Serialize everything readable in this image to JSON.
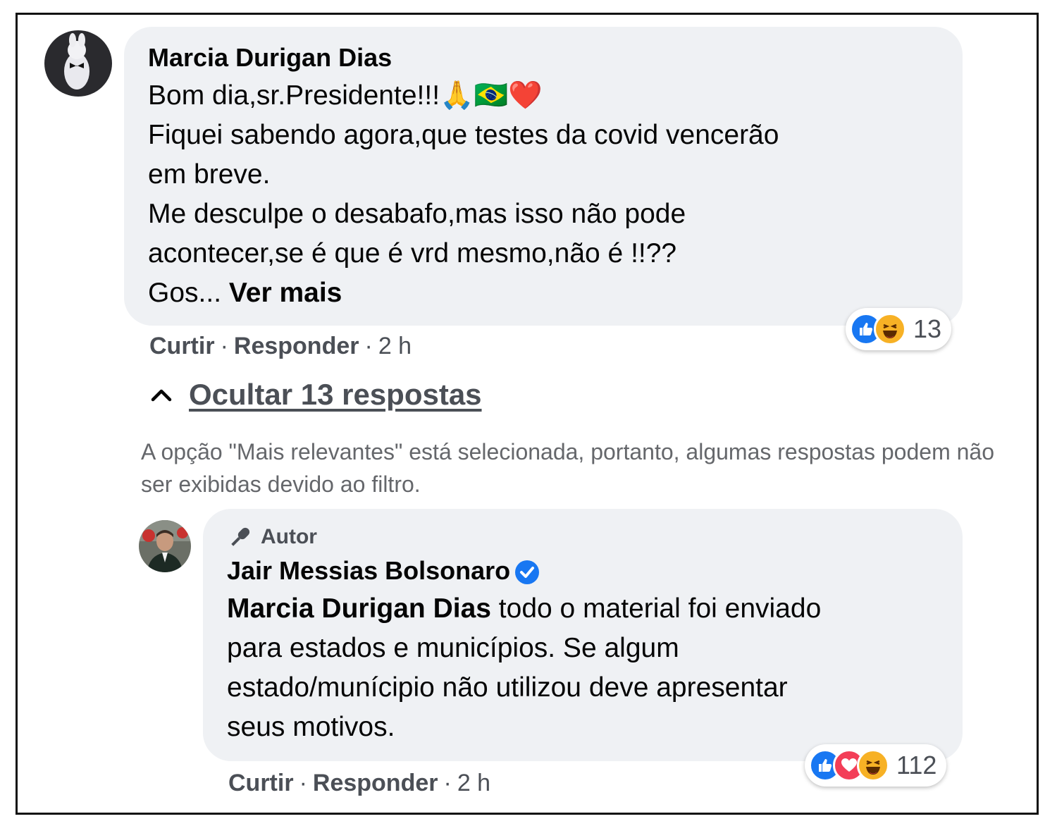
{
  "comment": {
    "author": "Marcia Durigan Dias",
    "lines": [
      "Bom dia,sr.Presidente!!!",
      "Fiquei sabendo agora,que testes da covid vencerão",
      "em breve.",
      "Me desculpe o desabafo,mas isso não pode",
      "acontecer,se é que é vrd mesmo,não é !!??",
      "Gos..."
    ],
    "emojis": [
      "🙏",
      "🇧🇷",
      "❤️"
    ],
    "see_more": "Ver mais",
    "like_label": "Curtir",
    "reply_label": "Responder",
    "time": "2 h",
    "reaction_count": "13",
    "reaction_icons": [
      "like-icon",
      "haha-icon"
    ]
  },
  "replies_toggle": {
    "label": "Ocultar 13 respostas",
    "icon": "chevron-up-icon"
  },
  "filter_notice": "A opção \"Mais relevantes\" está selecionada, portanto, algumas respostas podem não ser exibidas devido ao filtro.",
  "reply": {
    "badge": "Autor",
    "badge_icon": "microphone-icon",
    "author": "Jair Messias Bolsonaro",
    "verified_icon": "verified-badge-icon",
    "mention": "Marcia Durigan Dias",
    "lines": [
      " todo o material foi enviado",
      "para estados e municípios. Se algum",
      "estado/munícipio não utilizou deve apresentar",
      "seus motivos."
    ],
    "like_label": "Curtir",
    "reply_label": "Responder",
    "time": "2 h",
    "reaction_count": "112",
    "reaction_icons": [
      "like-icon",
      "love-icon",
      "haha-icon"
    ]
  },
  "colors": {
    "bubble": "#eff1f4",
    "like_blue": "#1877f2",
    "love_red": "#f33e58",
    "haha_yellow": "#f7b125",
    "meta_gray": "#4b4f56"
  }
}
